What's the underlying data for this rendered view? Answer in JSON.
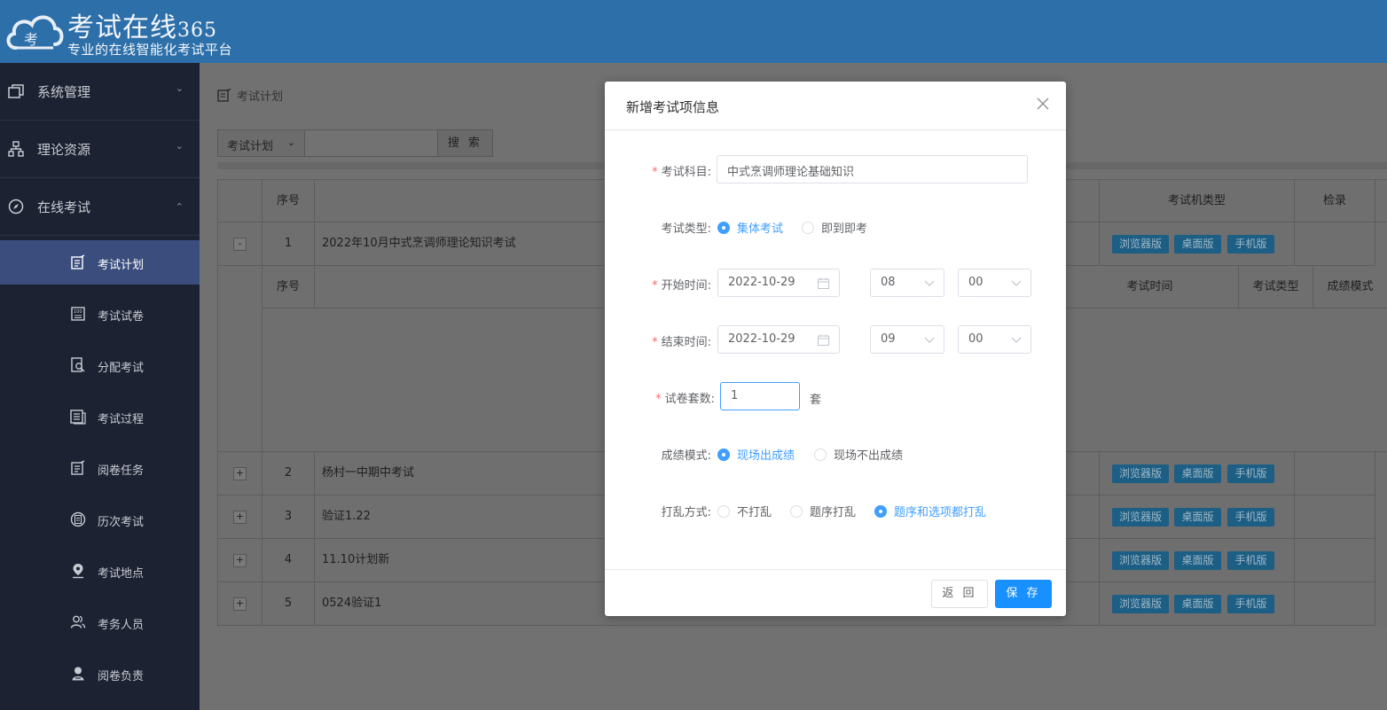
{
  "header": {
    "brand_title": "考试在线",
    "brand_number": "365",
    "brand_subtitle": "专业的在线智能化考试平台",
    "logo_char": "考"
  },
  "sidebar": {
    "groups": [
      {
        "label": "系统管理",
        "icon": "window-icon",
        "state": "collapsed"
      },
      {
        "label": "理论资源",
        "icon": "sitemap-icon",
        "state": "collapsed"
      },
      {
        "label": "在线考试",
        "icon": "compass-icon",
        "state": "expanded"
      }
    ],
    "items": [
      {
        "label": "考试计划",
        "icon": "edit-note-icon",
        "active": true
      },
      {
        "label": "考试试卷",
        "icon": "score-sheet-icon"
      },
      {
        "label": "分配考试",
        "icon": "document-search-icon"
      },
      {
        "label": "考试过程",
        "icon": "list-doc-icon"
      },
      {
        "label": "阅卷任务",
        "icon": "edit-note-icon"
      },
      {
        "label": "历次考试",
        "icon": "history-icon"
      },
      {
        "label": "考试地点",
        "icon": "location-icon"
      },
      {
        "label": "考务人员",
        "icon": "users-icon"
      },
      {
        "label": "阅卷负责",
        "icon": "person-icon"
      }
    ]
  },
  "main": {
    "breadcrumb": "考试计划",
    "search": {
      "select_value": "考试计划",
      "input_value": "",
      "button_label": "搜 索"
    },
    "table": {
      "header_seq": "序号",
      "header_machine_type": "考试机类型",
      "header_check": "检录",
      "sub_header_seq": "序号",
      "sub_header_exam_time": "考试时间",
      "sub_header_exam_type": "考试类型",
      "sub_header_score_mode": "成绩模式",
      "rows": [
        {
          "expander": "-",
          "seq": "1",
          "name": "2022年10月中式烹调师理论知识考试"
        },
        {
          "expander": "+",
          "seq": "2",
          "name": "杨村一中期中考试"
        },
        {
          "expander": "+",
          "seq": "3",
          "name": "验证1.22"
        },
        {
          "expander": "+",
          "seq": "4",
          "name": "11.10计划新"
        },
        {
          "expander": "+",
          "seq": "5",
          "name": "0524验证1"
        }
      ],
      "tags": {
        "browser": "浏览器版",
        "desktop": "桌面版",
        "mobile": "手机版"
      }
    }
  },
  "dialog": {
    "title": "新增考试项信息",
    "subject_label": "考试科目:",
    "subject_value": "中式烹调师理论基础知识",
    "exam_type_label": "考试类型:",
    "exam_type_options": [
      "集体考试",
      "即到即考"
    ],
    "exam_type_selected": "集体考试",
    "start_label": "开始时间:",
    "start_date": "2022-10-29",
    "start_hour": "08",
    "start_minute": "00",
    "end_label": "结束时间:",
    "end_date": "2022-10-29",
    "end_hour": "09",
    "end_minute": "00",
    "paper_sets_label": "试卷套数:",
    "paper_sets_value": "1",
    "paper_sets_unit": "套",
    "score_mode_label": "成绩模式:",
    "score_mode_options": [
      "现场出成绩",
      "现场不出成绩"
    ],
    "score_mode_selected": "现场出成绩",
    "shuffle_label": "打乱方式:",
    "shuffle_options": [
      "不打乱",
      "题序打乱",
      "题序和选项都打乱"
    ],
    "shuffle_selected": "题序和选项都打乱",
    "back_button": "返 回",
    "save_button": "保 存"
  },
  "colors": {
    "header_bg": "#2d6fa9",
    "sidebar_bg": "#1c2232",
    "sidebar_active": "#3b4d7d",
    "primary": "#409eff",
    "save_button": "#1890ff",
    "required": "#f56c6c",
    "tag_bg": "#1d5e84"
  }
}
